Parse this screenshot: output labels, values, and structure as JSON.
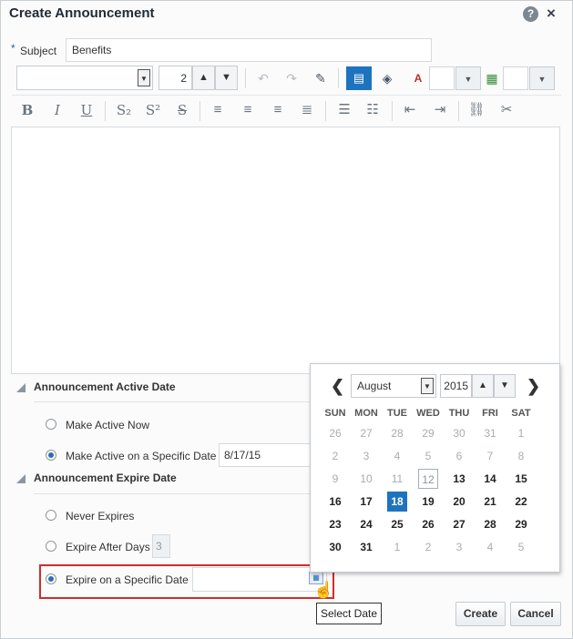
{
  "dialog": {
    "title": "Create Announcement",
    "help_icon": "?",
    "close_icon": "×"
  },
  "subject": {
    "required_mark": "*",
    "label": "Subject",
    "value": "Benefits"
  },
  "toolbar": {
    "font_size": "2",
    "icons_row1": [
      "undo-icon",
      "redo-icon",
      "eraser-icon",
      "rich-text-mode-icon",
      "source-code-icon",
      "text-color-icon",
      "background-color-icon"
    ],
    "icons_row2": [
      "bold-icon",
      "italic-icon",
      "underline-icon",
      "subscript-icon",
      "superscript-icon",
      "strikethrough-icon",
      "align-left-icon",
      "align-center-icon",
      "align-right-icon",
      "justify-icon",
      "bullet-list-icon",
      "numbered-list-icon",
      "outdent-icon",
      "indent-icon",
      "link-icon",
      "unlink-icon"
    ]
  },
  "active_section": {
    "title": "Announcement Active Date",
    "option_now": "Make Active Now",
    "option_specific": "Make Active on a Specific Date",
    "date_value": "8/17/15"
  },
  "expire_section": {
    "title": "Announcement Expire Date",
    "option_never": "Never Expires",
    "option_after_days": "Expire After Days",
    "days_value": "3",
    "option_specific": "Expire on a Specific Date",
    "date_value": ""
  },
  "tooltip": "Select Date",
  "buttons": {
    "create": "Create",
    "cancel": "Cancel"
  },
  "calendar": {
    "prev": "❮",
    "next": "❯",
    "month": "August",
    "year": "2015",
    "weekdays": [
      "SUN",
      "MON",
      "TUE",
      "WED",
      "THU",
      "FRI",
      "SAT"
    ],
    "weeks": [
      [
        "26",
        "27",
        "28",
        "29",
        "30",
        "31",
        "1"
      ],
      [
        "2",
        "3",
        "4",
        "5",
        "6",
        "7",
        "8"
      ],
      [
        "9",
        "10",
        "11",
        "12",
        "13",
        "14",
        "15"
      ],
      [
        "16",
        "17",
        "18",
        "19",
        "20",
        "21",
        "22"
      ],
      [
        "23",
        "24",
        "25",
        "26",
        "27",
        "28",
        "29"
      ],
      [
        "30",
        "31",
        "1",
        "2",
        "3",
        "4",
        "5"
      ]
    ],
    "selected_day": "18",
    "today_day": "12",
    "selected_color": "#1e73be"
  }
}
